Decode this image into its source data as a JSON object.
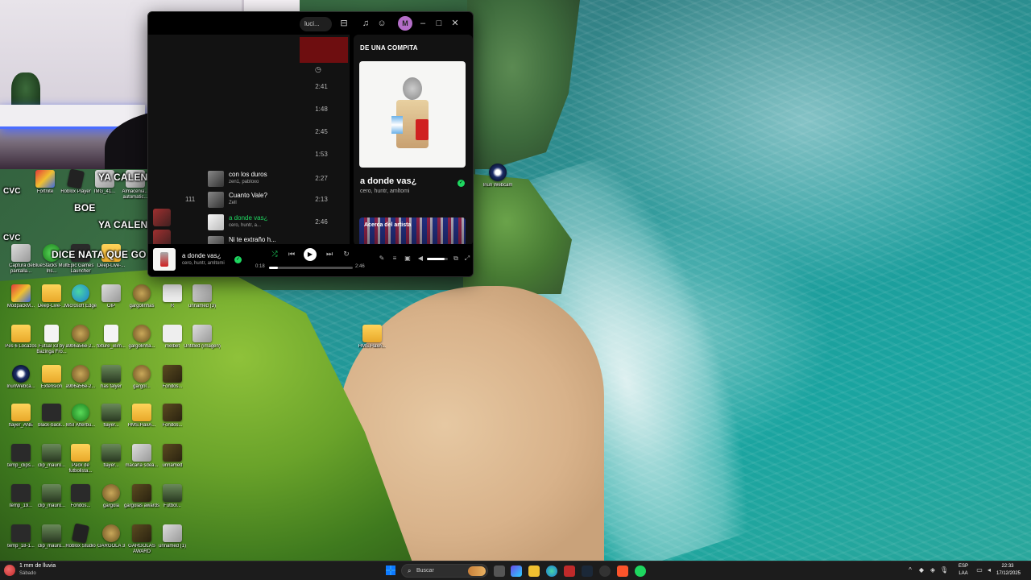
{
  "webcam": {
    "chat": [
      {
        "prefix": "CVC",
        "user": "",
        "message": "YA CALENTASTE LAS CACHAS GO"
      },
      {
        "prefix": "",
        "user": "",
        "message": "BOE"
      },
      {
        "prefix": "CVC",
        "user": "",
        "message": "YA CALENTASTE LAS CACHAS GO"
      },
      {
        "prefix": "CVC",
        "user": "",
        "message": "DICE NATA QUE GO CVC"
      }
    ]
  },
  "desktop": {
    "icons": [
      {
        "label": "Fortnite",
        "type": "mod"
      },
      {
        "label": "Roblox Player",
        "type": "roblox"
      },
      {
        "label": "IMG_41...",
        "type": "img"
      },
      {
        "label": "Almacenia... automatic...",
        "type": "img"
      },
      {
        "label": "Captura de pantalla...",
        "type": "img"
      },
      {
        "label": "BlueStacks Multi-Ins...",
        "type": "green"
      },
      {
        "label": "Epic Games Launcher",
        "type": "dark"
      },
      {
        "label": "Deep-Live-...",
        "type": "folder"
      },
      {
        "label": "ModpackM...",
        "type": "mod"
      },
      {
        "label": "Deep-Live-...",
        "type": "folder"
      },
      {
        "label": "Microsoft Edge",
        "type": "edge"
      },
      {
        "label": "OIP",
        "type": "img"
      },
      {
        "label": "gargolinhas",
        "type": "coin"
      },
      {
        "label": "R",
        "type": "white"
      },
      {
        "label": "unnamed (3)",
        "type": "img"
      },
      {
        "label": "Pes 6 Locazos",
        "type": "folder"
      },
      {
        "label": "Futsal x3 by Bazinga Fro...",
        "type": "file"
      },
      {
        "label": "a9b6a56e-2...",
        "type": "coin"
      },
      {
        "label": "fixture_elim...",
        "type": "file"
      },
      {
        "label": "gargolinha...",
        "type": "coin"
      },
      {
        "label": "melbet",
        "type": "white"
      },
      {
        "label": "Untitled (imagen)",
        "type": "img"
      },
      {
        "label": "IriunWebca...",
        "type": "cam"
      },
      {
        "label": "Extension",
        "type": "folder"
      },
      {
        "label": "a9b6a56e-2...",
        "type": "coin"
      },
      {
        "label": "has falyer",
        "type": "char"
      },
      {
        "label": "gargol...",
        "type": "coin"
      },
      {
        "label": "Fondos...",
        "type": "brown"
      },
      {
        "label": "flayer_ANE",
        "type": "folder"
      },
      {
        "label": "black-back...",
        "type": "dark"
      },
      {
        "label": "MSI Afterbu...",
        "type": "green"
      },
      {
        "label": "flayer...",
        "type": "char"
      },
      {
        "label": "HMS.HaxA...",
        "type": "folder"
      },
      {
        "label": "Fondos...",
        "type": "brown"
      },
      {
        "label": "temp_clips...",
        "type": "dark"
      },
      {
        "label": "clip_mauro...",
        "type": "char"
      },
      {
        "label": "Pack de futbolista...",
        "type": "folder"
      },
      {
        "label": "flayer...",
        "type": "char"
      },
      {
        "label": "macarla sdea...",
        "type": "img"
      },
      {
        "label": "unnamed",
        "type": "brown"
      },
      {
        "label": "temp_19...",
        "type": "dark"
      },
      {
        "label": "clip_mauro...",
        "type": "char"
      },
      {
        "label": "Fondos...",
        "type": "dark"
      },
      {
        "label": "gargola",
        "type": "coin"
      },
      {
        "label": "gargolas awards",
        "type": "brown"
      },
      {
        "label": "Futbol...",
        "type": "char"
      },
      {
        "label": "temp_18-1...",
        "type": "dark"
      },
      {
        "label": "clip_mauro...",
        "type": "char"
      },
      {
        "label": "Roblox Studio",
        "type": "roblox"
      },
      {
        "label": "GARGOLA 3",
        "type": "coin"
      },
      {
        "label": "GARGOLAS AWARD",
        "type": "brown"
      },
      {
        "label": "unnamed (1)",
        "type": "img"
      },
      {
        "label": "HMS.HaxA...",
        "type": "folder"
      },
      {
        "label": "Iriun Webcam",
        "type": "cam"
      }
    ]
  },
  "spotify": {
    "search_fragment": "luci...",
    "avatar_letter": "M",
    "clock_icon": "clock-icon",
    "durations_top": [
      "2:41",
      "1:48",
      "2:45",
      "1:53"
    ],
    "rows": [
      {
        "num": "",
        "title": "con los duros",
        "artists": "zen1, pabloxo",
        "duration": "2:27",
        "active": false
      },
      {
        "num": "111",
        "title": "Cuanto Vale?",
        "artists": "Zell",
        "duration": "2:13",
        "active": false
      },
      {
        "num": "",
        "title": "a donde vas¿",
        "artists": "cero, huntr, a...",
        "duration": "2:46",
        "active": true
      },
      {
        "num": "",
        "title": "Ni te extraño h...",
        "artists": "",
        "duration": "",
        "active": false
      }
    ],
    "panel": {
      "title": "DE UNA COMPITA",
      "track_title": "a donde vas¿",
      "track_artists": "cero, huntr, amltomi",
      "about_label": "Acerca del artista"
    },
    "player": {
      "title": "a donde vas¿",
      "artists": "cero, huntr, amltomi",
      "elapsed": "0:18",
      "total": "2:46",
      "progress": 0.11,
      "volume": 0.85
    }
  },
  "taskbar": {
    "weather_text": "1 mm de lluvia",
    "weather_sub": "Sábado",
    "search_placeholder": "Buscar",
    "lang_top": "ESP",
    "lang_bottom": "LAA",
    "time": "22:33",
    "date": "17/12/2025"
  }
}
